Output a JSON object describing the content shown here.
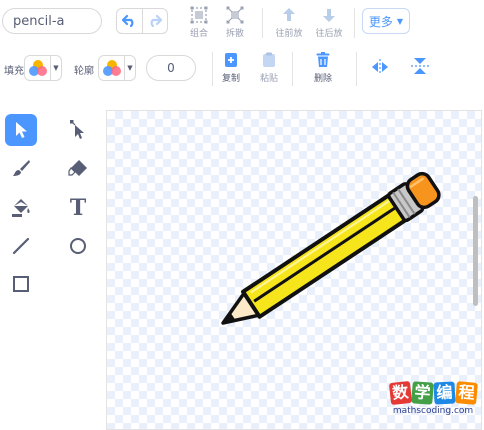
{
  "costume_name": "pencil-a",
  "toolbar": {
    "undo_icon": "undo-icon",
    "redo_icon": "redo-icon",
    "group_label": "组合",
    "ungroup_label": "拆散",
    "forward_label": "往前放",
    "backward_label": "往后放",
    "more_label": "更多"
  },
  "fill": {
    "label": "填充"
  },
  "outline": {
    "label": "轮廓",
    "width": "0"
  },
  "actions": {
    "copy_label": "复制",
    "paste_label": "粘贴",
    "delete_label": "删除"
  },
  "tools": [
    {
      "name": "select-tool",
      "icon": "arrow-icon",
      "selected": true
    },
    {
      "name": "reshape-tool",
      "icon": "reshape-icon"
    },
    {
      "name": "brush-tool",
      "icon": "brush-icon"
    },
    {
      "name": "eraser-tool",
      "icon": "eraser-icon"
    },
    {
      "name": "fill-tool",
      "icon": "bucket-icon"
    },
    {
      "name": "text-tool",
      "icon": "text-icon"
    },
    {
      "name": "line-tool",
      "icon": "line-icon"
    },
    {
      "name": "circle-tool",
      "icon": "circle-icon"
    },
    {
      "name": "rectangle-tool",
      "icon": "rectangle-icon"
    }
  ],
  "text_tool_glyph": "T",
  "watermark": {
    "chars": [
      "数",
      "学",
      "编",
      "程"
    ],
    "colors": [
      "#e53935",
      "#43a047",
      "#1e88e5",
      "#fb8c00"
    ],
    "url": "mathscoding.com"
  },
  "colors": {
    "accent": "#4c97ff",
    "pencil_body": "#f7e51c",
    "pencil_eraser": "#f7941d",
    "pencil_ferrule": "#c8c8c8"
  }
}
